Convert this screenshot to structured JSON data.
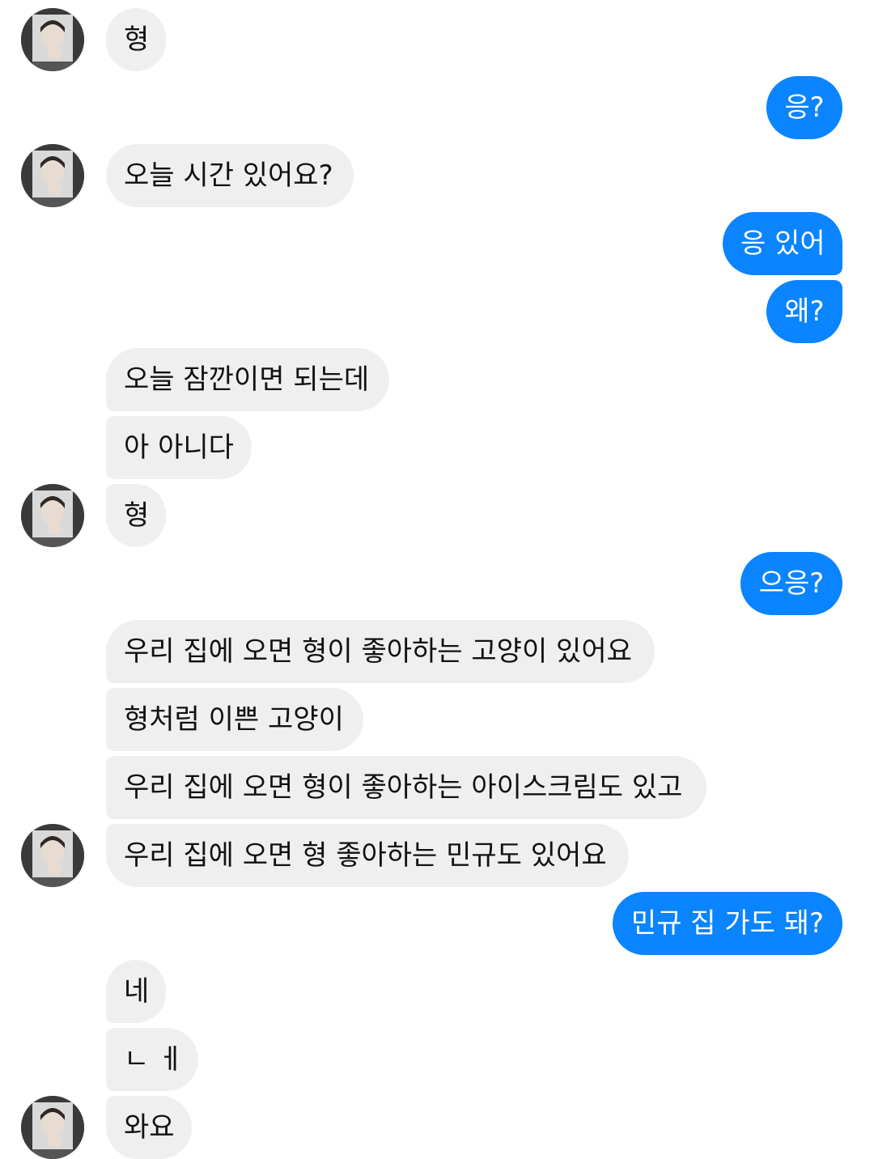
{
  "colors": {
    "incoming_bubble": "#efefef",
    "outgoing_bubble": "#0a84ff",
    "incoming_text": "#111111",
    "outgoing_text": "#ffffff"
  },
  "avatar_icon": "profile-photo",
  "messages": [
    {
      "side": "in",
      "text": "형"
    },
    {
      "side": "out",
      "text": "응?"
    },
    {
      "side": "in",
      "text": "오늘 시간 있어요?"
    },
    {
      "side": "out",
      "text": "응 있어"
    },
    {
      "side": "out",
      "text": "왜?"
    },
    {
      "side": "in",
      "text": "오늘 잠깐이면 되는데"
    },
    {
      "side": "in",
      "text": "아 아니다"
    },
    {
      "side": "in",
      "text": "형"
    },
    {
      "side": "out",
      "text": "으응?"
    },
    {
      "side": "in",
      "text": "우리 집에 오면 형이 좋아하는 고양이 있어요"
    },
    {
      "side": "in",
      "text": "형처럼 이쁜 고양이"
    },
    {
      "side": "in",
      "text": "우리 집에 오면 형이 좋아하는 아이스크림도 있고"
    },
    {
      "side": "in",
      "text": "우리 집에 오면 형 좋아하는 민규도 있어요"
    },
    {
      "side": "out",
      "text": "민규 집 가도 돼?"
    },
    {
      "side": "in",
      "text": "네"
    },
    {
      "side": "in",
      "text": "ㄴ ㅔ"
    },
    {
      "side": "in",
      "text": "와요"
    }
  ]
}
